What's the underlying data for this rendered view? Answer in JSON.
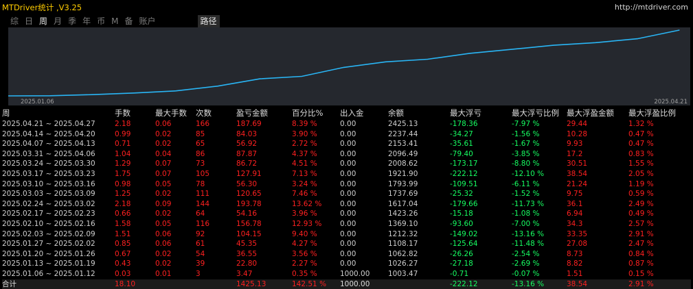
{
  "app": {
    "title": "MTDriver统计 ,V3.25",
    "link": "http://mtdriver.com"
  },
  "tabs": [
    {
      "label": "综",
      "active": false
    },
    {
      "label": "日",
      "active": false
    },
    {
      "label": "周",
      "active": true
    },
    {
      "label": "月",
      "active": false
    },
    {
      "label": "季",
      "active": false
    },
    {
      "label": "年",
      "active": false
    },
    {
      "label": "币",
      "active": false
    },
    {
      "label": "M",
      "active": false
    },
    {
      "label": "备",
      "active": false
    },
    {
      "label": "账户",
      "active": false
    }
  ],
  "path_tab": "路径",
  "colors": {
    "line": "#29b6f6",
    "positive": "#ff2020",
    "negative": "#16ff62",
    "chart_bg": "#25282e"
  },
  "chart_data": {
    "type": "line",
    "x_start_label": "2025.01.06",
    "x_end_label": "2025.04.21",
    "x": [
      "2025.01.06",
      "2025.01.13",
      "2025.01.20",
      "2025.01.27",
      "2025.02.03",
      "2025.02.10",
      "2025.02.17",
      "2025.02.24",
      "2025.03.03",
      "2025.03.10",
      "2025.03.17",
      "2025.03.24",
      "2025.03.31",
      "2025.04.07",
      "2025.04.14",
      "2025.04.21"
    ],
    "values": [
      1000.0,
      1003.47,
      1026.27,
      1062.82,
      1108.17,
      1212.32,
      1369.1,
      1423.26,
      1617.04,
      1737.69,
      1793.99,
      1921.9,
      2008.62,
      2096.49,
      2153.41,
      2237.44,
      2425.13
    ]
  },
  "table": {
    "headers": [
      "周",
      "手数",
      "最大手数",
      "次数",
      "盈亏金额",
      "百分比%",
      "出入金",
      "余额",
      "最大浮亏",
      "最大浮亏比例",
      "最大浮盈金额",
      "最大浮盈比例"
    ],
    "rows": [
      [
        "2025.04.21 ~ 2025.04.27",
        "2.18",
        "0.06",
        "166",
        "187.69",
        "8.39 %",
        "0.00",
        "2425.13",
        "-178.36",
        "-7.97 %",
        "29.44",
        "1.32 %"
      ],
      [
        "2025.04.14 ~ 2025.04.20",
        "0.99",
        "0.02",
        "85",
        "84.03",
        "3.90 %",
        "0.00",
        "2237.44",
        "-34.27",
        "-1.56 %",
        "10.28",
        "0.47 %"
      ],
      [
        "2025.04.07 ~ 2025.04.13",
        "0.71",
        "0.02",
        "65",
        "56.92",
        "2.72 %",
        "0.00",
        "2153.41",
        "-35.61",
        "-1.67 %",
        "9.93",
        "0.47 %"
      ],
      [
        "2025.03.31 ~ 2025.04.06",
        "1.04",
        "0.04",
        "86",
        "87.87",
        "4.37 %",
        "0.00",
        "2096.49",
        "-79.40",
        "-3.85 %",
        "17.2",
        "0.83 %"
      ],
      [
        "2025.03.24 ~ 2025.03.30",
        "1.29",
        "0.07",
        "73",
        "86.72",
        "4.51 %",
        "0.00",
        "2008.62",
        "-173.17",
        "-8.80 %",
        "30.51",
        "1.55 %"
      ],
      [
        "2025.03.17 ~ 2025.03.23",
        "1.75",
        "0.07",
        "105",
        "127.91",
        "7.13 %",
        "0.00",
        "1921.90",
        "-222.12",
        "-12.10 %",
        "38.54",
        "2.05 %"
      ],
      [
        "2025.03.10 ~ 2025.03.16",
        "0.98",
        "0.05",
        "78",
        "56.30",
        "3.24 %",
        "0.00",
        "1793.99",
        "-109.51",
        "-6.11 %",
        "21.24",
        "1.19 %"
      ],
      [
        "2025.03.03 ~ 2025.03.09",
        "1.25",
        "0.02",
        "111",
        "120.65",
        "7.46 %",
        "0.00",
        "1737.69",
        "-25.32",
        "-1.52 %",
        "9.75",
        "0.59 %"
      ],
      [
        "2025.02.24 ~ 2025.03.02",
        "2.18",
        "0.09",
        "144",
        "193.78",
        "13.62 %",
        "0.00",
        "1617.04",
        "-179.66",
        "-11.73 %",
        "36.1",
        "2.49 %"
      ],
      [
        "2025.02.17 ~ 2025.02.23",
        "0.66",
        "0.02",
        "64",
        "54.16",
        "3.96 %",
        "0.00",
        "1423.26",
        "-15.18",
        "-1.08 %",
        "6.94",
        "0.49 %"
      ],
      [
        "2025.02.10 ~ 2025.02.16",
        "1.58",
        "0.05",
        "116",
        "156.78",
        "12.93 %",
        "0.00",
        "1369.10",
        "-93.60",
        "-7.00 %",
        "34.3",
        "2.57 %"
      ],
      [
        "2025.02.03 ~ 2025.02.09",
        "1.51",
        "0.06",
        "92",
        "104.15",
        "9.40 %",
        "0.00",
        "1212.32",
        "-149.02",
        "-13.16 %",
        "33.35",
        "2.91 %"
      ],
      [
        "2025.01.27 ~ 2025.02.02",
        "0.85",
        "0.06",
        "61",
        "45.35",
        "4.27 %",
        "0.00",
        "1108.17",
        "-125.64",
        "-11.48 %",
        "27.08",
        "2.47 %"
      ],
      [
        "2025.01.20 ~ 2025.01.26",
        "0.67",
        "0.02",
        "54",
        "36.55",
        "3.56 %",
        "0.00",
        "1062.82",
        "-26.26",
        "-2.54 %",
        "8.73",
        "0.84 %"
      ],
      [
        "2025.01.13 ~ 2025.01.19",
        "0.43",
        "0.02",
        "39",
        "22.80",
        "2.27 %",
        "0.00",
        "1026.27",
        "-27.18",
        "-2.69 %",
        "8.82",
        "0.87 %"
      ],
      [
        "2025.01.06 ~ 2025.01.12",
        "0.03",
        "0.01",
        "3",
        "3.47",
        "0.35 %",
        "1000.00",
        "1003.47",
        "-0.71",
        "-0.07 %",
        "1.51",
        "0.15 %"
      ]
    ],
    "total": [
      "合计",
      "18.10",
      "",
      "",
      "1425.13",
      "142.51 %",
      "1000.00",
      "",
      "-222.12",
      "-13.16 %",
      "38.54",
      "2.91 %"
    ]
  }
}
